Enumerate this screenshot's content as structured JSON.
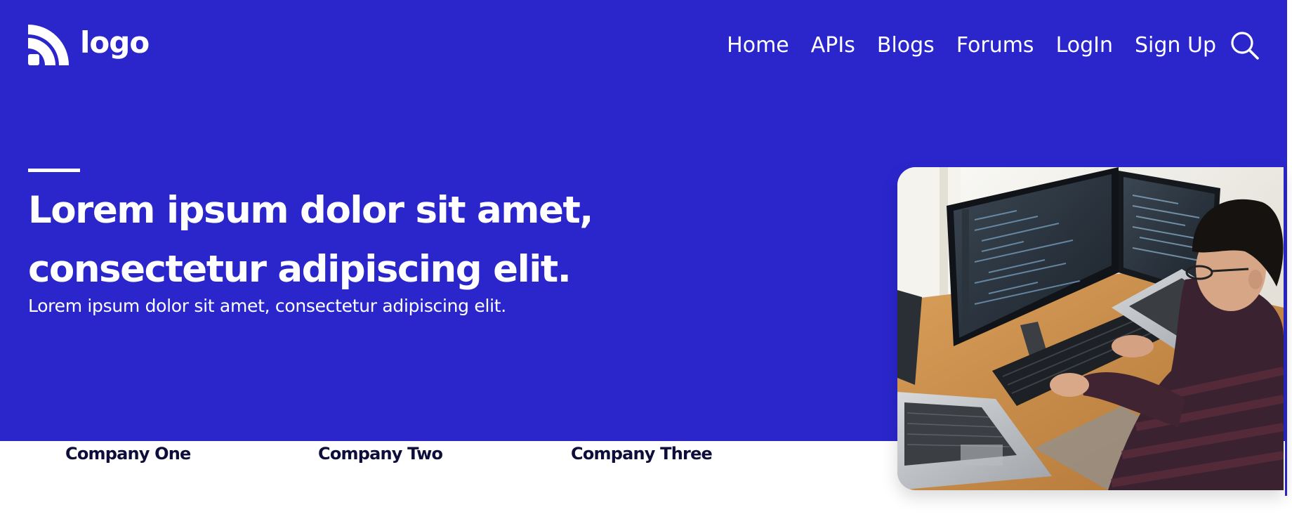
{
  "colors": {
    "hero_background": "#2a26cc",
    "text_on_hero": "#ffffff",
    "company_text": "#0e0e3a"
  },
  "header": {
    "logo": {
      "icon": "rss-arcs-logo-icon",
      "text": "logo"
    },
    "nav": [
      {
        "label": "Home"
      },
      {
        "label": "APIs"
      },
      {
        "label": "Blogs"
      },
      {
        "label": "Forums"
      },
      {
        "label": "LogIn"
      },
      {
        "label": "Sign Up"
      }
    ],
    "search_icon": "search-icon"
  },
  "hero": {
    "title_line1": "Lorem ipsum dolor sit amet,",
    "title_line2": "consectetur adipiscing elit.",
    "subtitle": "Lorem ipsum dolor sit amet, consectetur adipiscing elit.",
    "image": "developer-at-computer-photo"
  },
  "companies": [
    {
      "name": "Company One"
    },
    {
      "name": "Company Two"
    },
    {
      "name": "Company Three"
    }
  ]
}
